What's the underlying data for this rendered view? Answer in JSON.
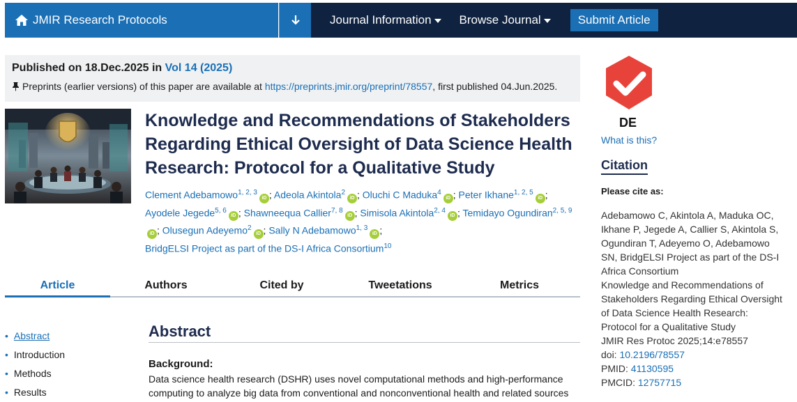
{
  "nav": {
    "brand": "JMIR Research Protocols",
    "journal_info": "Journal Information",
    "browse": "Browse Journal",
    "submit": "Submit Article"
  },
  "pub": {
    "published_prefix": "Published on 18.Dec.2025 in",
    "volume": "Vol 14 (2025)",
    "preprint_prefix": "Preprints (earlier versions) of this paper are available at",
    "preprint_url": "https://preprints.jmir.org/preprint/78557",
    "preprint_suffix": ", first published 04.Jun.2025."
  },
  "article": {
    "title": "Knowledge and Recommendations of Stakeholders Regarding Ethical Oversight of Data Science Health Research: Protocol for a Qualitative Study",
    "authors": [
      {
        "name": "Clement Adebamowo",
        "sup": "1, 2, 3"
      },
      {
        "name": "Adeola Akintola",
        "sup": "2"
      },
      {
        "name": "Oluchi C Maduka",
        "sup": "4"
      },
      {
        "name": "Peter Ikhane",
        "sup": "1, 2, 5"
      },
      {
        "name": "Ayodele Jegede",
        "sup": "5, 6"
      },
      {
        "name": "Shawneequa Callier",
        "sup": "7, 8"
      },
      {
        "name": "Simisola Akintola",
        "sup": "2, 4"
      },
      {
        "name": "Temidayo Ogundiran",
        "sup": "2, 5, 9"
      },
      {
        "name": "Olusegun Adeyemo",
        "sup": "2"
      },
      {
        "name": "Sally N Adebamowo",
        "sup": "1, 3"
      }
    ],
    "consortium": "BridgELSI Project as part of the DS-I Africa Consortium",
    "consortium_sup": "10"
  },
  "tabs": [
    "Article",
    "Authors",
    "Cited by",
    "Tweetations",
    "Metrics"
  ],
  "toc": [
    "Abstract",
    "Introduction",
    "Methods",
    "Results"
  ],
  "abstract": {
    "heading": "Abstract",
    "background_heading": "Background:",
    "background_text": "Data science health research (DSHR) uses novel computational methods and high-performance computing to analyze big data from conventional and nonconventional health and related sources"
  },
  "sidebar": {
    "badge_label": "DE",
    "what_link": "What is this?",
    "citation_heading": "Citation",
    "please_cite": "Please cite as:",
    "citation_authors": "Adebamowo C, Akintola A, Maduka OC, Ikhane P, Jegede A, Callier S, Akintola S, Ogundiran T, Adeyemo O, Adebamowo SN, BridgELSI Project as part of the DS-I Africa Consortium",
    "citation_title": "Knowledge and Recommendations of Stakeholders Regarding Ethical Oversight of Data Science Health Research: Protocol for a Qualitative Study",
    "citation_journal": "JMIR Res Protoc 2025;14:e78557",
    "doi_label": "doi:",
    "doi": "10.2196/78557",
    "pmid_label": "PMID:",
    "pmid": "41130595",
    "pmcid_label": "PMCID:",
    "pmcid": "12757715"
  },
  "colors": {
    "brand_blue": "#1a6fb5",
    "nav_dark": "#0f2240",
    "orcid_green": "#a6ce39",
    "badge_red": "#e8433b",
    "title_navy": "#1d2b4e"
  },
  "icons": [
    "home-icon",
    "download-arrow-icon",
    "pin-icon",
    "orcid-icon",
    "check-badge-icon"
  ]
}
